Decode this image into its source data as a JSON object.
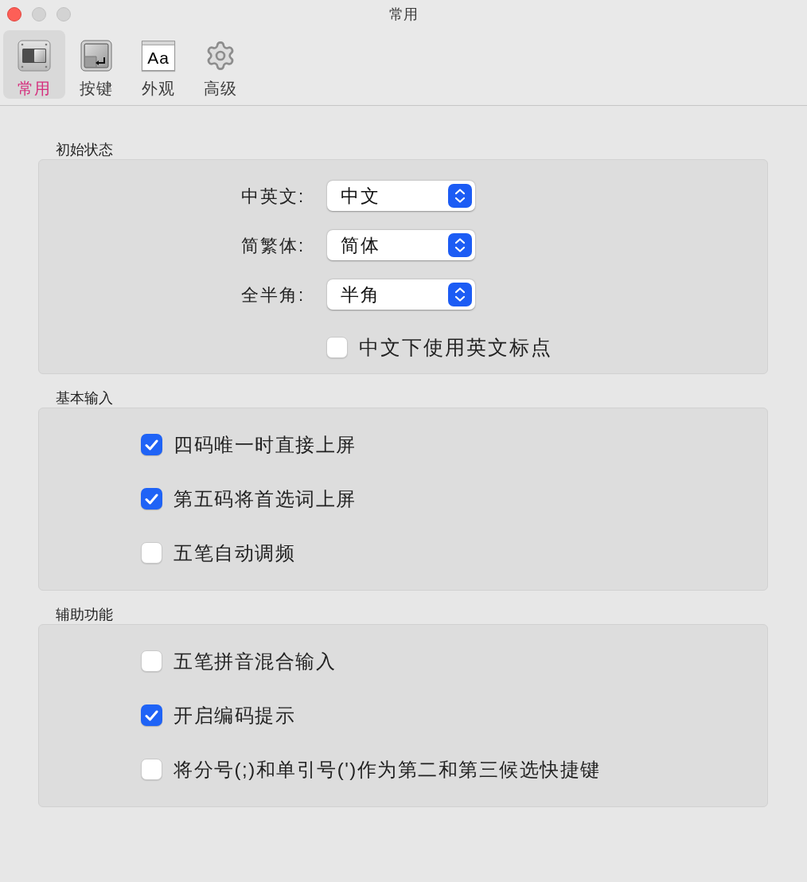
{
  "window": {
    "title": "常用"
  },
  "toolbar": {
    "tabs": [
      {
        "label": "常用",
        "selected": true
      },
      {
        "label": "按键",
        "selected": false
      },
      {
        "label": "外观",
        "selected": false,
        "icon_text": "Aa"
      },
      {
        "label": "高级",
        "selected": false
      }
    ]
  },
  "sections": [
    {
      "title": "初始状态",
      "rows": [
        {
          "kind": "popup",
          "label": "中英文:",
          "value": "中文"
        },
        {
          "kind": "popup",
          "label": "简繁体:",
          "value": "简体"
        },
        {
          "kind": "popup",
          "label": "全半角:",
          "value": "半角"
        },
        {
          "kind": "checkbox",
          "label": "中文下使用英文标点",
          "checked": false
        }
      ]
    },
    {
      "title": "基本输入",
      "rows": [
        {
          "kind": "checkbox",
          "label": "四码唯一时直接上屏",
          "checked": true
        },
        {
          "kind": "checkbox",
          "label": "第五码将首选词上屏",
          "checked": true
        },
        {
          "kind": "checkbox",
          "label": "五笔自动调频",
          "checked": false
        }
      ]
    },
    {
      "title": "辅助功能",
      "rows": [
        {
          "kind": "checkbox",
          "label": "五笔拼音混合输入",
          "checked": false
        },
        {
          "kind": "checkbox",
          "label": "开启编码提示",
          "checked": true
        },
        {
          "kind": "checkbox",
          "label": "将分号(;)和单引号(')作为第二和第三候选快捷键",
          "checked": false
        }
      ]
    }
  ]
}
